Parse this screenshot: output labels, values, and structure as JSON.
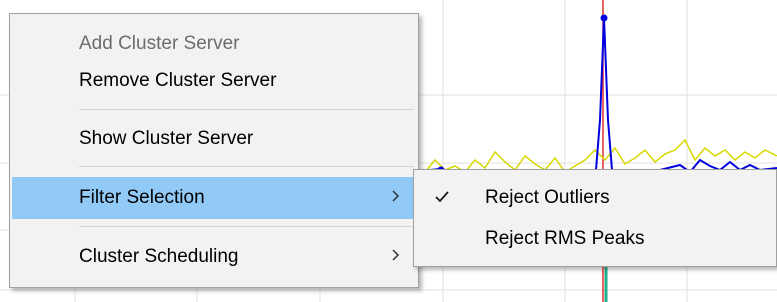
{
  "context_menu": {
    "items": [
      {
        "label": "Add Cluster Server",
        "enabled": false
      },
      {
        "label": "Remove Cluster Server",
        "enabled": true
      },
      {
        "label": "Show Cluster Server",
        "enabled": true
      },
      {
        "label": "Filter Selection",
        "enabled": true,
        "submenu": true,
        "highlighted": true
      },
      {
        "label": "Cluster Scheduling",
        "enabled": true,
        "submenu": true
      }
    ],
    "submenu_arrow": "chevron-right-icon"
  },
  "filter_submenu": {
    "items": [
      {
        "label": "Reject Outliers",
        "checked": true
      },
      {
        "label": "Reject RMS Peaks",
        "checked": false
      }
    ],
    "check_icon": "checkmark-icon"
  },
  "colors": {
    "highlight": "#91c9f7",
    "menu_background": "#f2f2f2",
    "series_red": "#e03030",
    "series_blue": "#0000e0",
    "series_yellow": "#d8d800",
    "series_green": "#20b090"
  }
}
